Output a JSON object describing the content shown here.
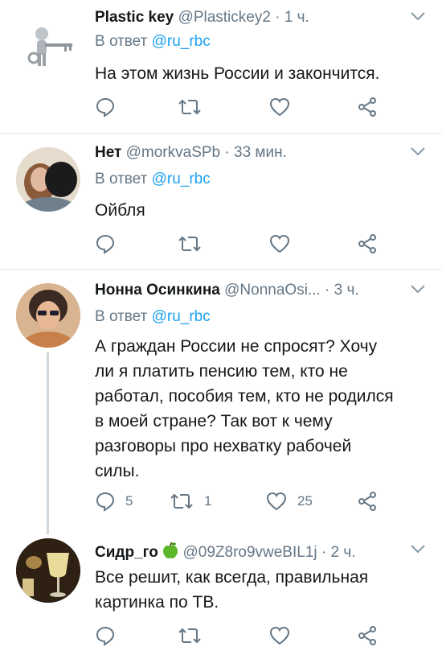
{
  "tweets": [
    {
      "name": "Plastic key",
      "handle": "@Plastickey2",
      "dot": "·",
      "time": "1 ч.",
      "reply_prefix": "В ответ ",
      "reply_to": "@ru_rbc",
      "text": "На этом жизнь России и закончится.",
      "replies": "",
      "retweets": "",
      "likes": ""
    },
    {
      "name": "Нет",
      "handle": "@morkvaSPb",
      "dot": "·",
      "time": "33 мин.",
      "reply_prefix": "В ответ ",
      "reply_to": "@ru_rbc",
      "text": "Ойбля",
      "replies": "",
      "retweets": "",
      "likes": ""
    },
    {
      "name": "Нонна Осинкина",
      "handle": "@NonnaOsi...",
      "dot": "·",
      "time": "3 ч.",
      "reply_prefix": "В ответ ",
      "reply_to": "@ru_rbc",
      "text_lines": [
        "А граждан России не спросят? Хочу",
        "ли я платить пенсию тем, кто не",
        "работал, пособия тем, кто не родился",
        "в моей стране? Так вот к чему",
        "разговоры про нехватку рабочей",
        "силы."
      ],
      "replies": "5",
      "retweets": "1",
      "likes": "25"
    },
    {
      "name": "Сидр_го",
      "handle": "@09Z8ro9vweBIL1j",
      "dot": "·",
      "time": "2 ч.",
      "text_lines": [
        "Все решит, как всегда, правильная",
        "картинка по ТВ."
      ],
      "replies": "",
      "retweets": "",
      "likes": ""
    }
  ],
  "colors": {
    "name": "#14171a",
    "secondary": "#657786",
    "link": "#1da1f2",
    "divider": "#e1e8ed",
    "apple_green": "#5cb82a"
  },
  "icons": [
    "reply-icon",
    "retweet-icon",
    "like-icon",
    "share-icon",
    "caret-down-icon",
    "green-apple-icon"
  ]
}
